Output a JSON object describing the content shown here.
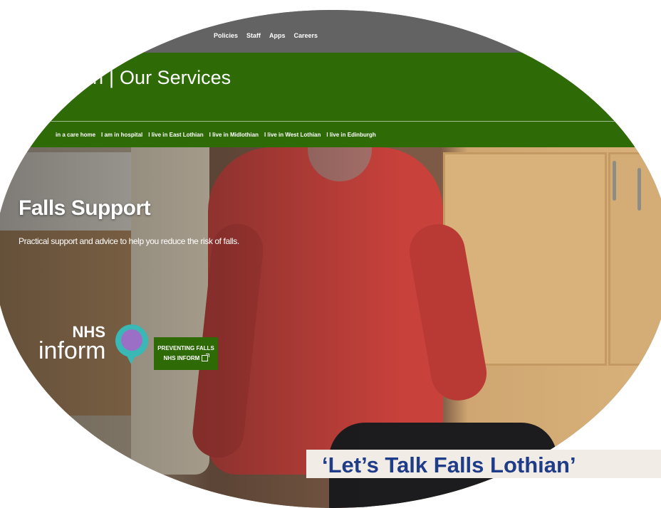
{
  "top_nav": {
    "items": [
      "Policies",
      "Staff",
      "Apps",
      "Careers"
    ]
  },
  "header": {
    "brand_partial": "ian",
    "separator": "|",
    "section": "Our Services"
  },
  "sub_nav": {
    "items": [
      "in a care home",
      "I am in hospital",
      "I live in East Lothian",
      "I live in Midlothian",
      "I live in West Lothian",
      "I live in Edinburgh"
    ]
  },
  "hero": {
    "title": "Falls Support",
    "subtitle": "Practical support and advice to help you reduce the risk of falls."
  },
  "nhs_inform": {
    "nhs_text": "NHS",
    "inform_text": "inform"
  },
  "preventing_button": {
    "line1": "PREVENTING FALLS",
    "line2": "NHS INFORM"
  },
  "banner": {
    "text": "‘Let’s Talk Falls Lothian’"
  },
  "colors": {
    "green": "#2e6b06",
    "topbar": "#636363",
    "banner_text": "#1f3c88"
  }
}
